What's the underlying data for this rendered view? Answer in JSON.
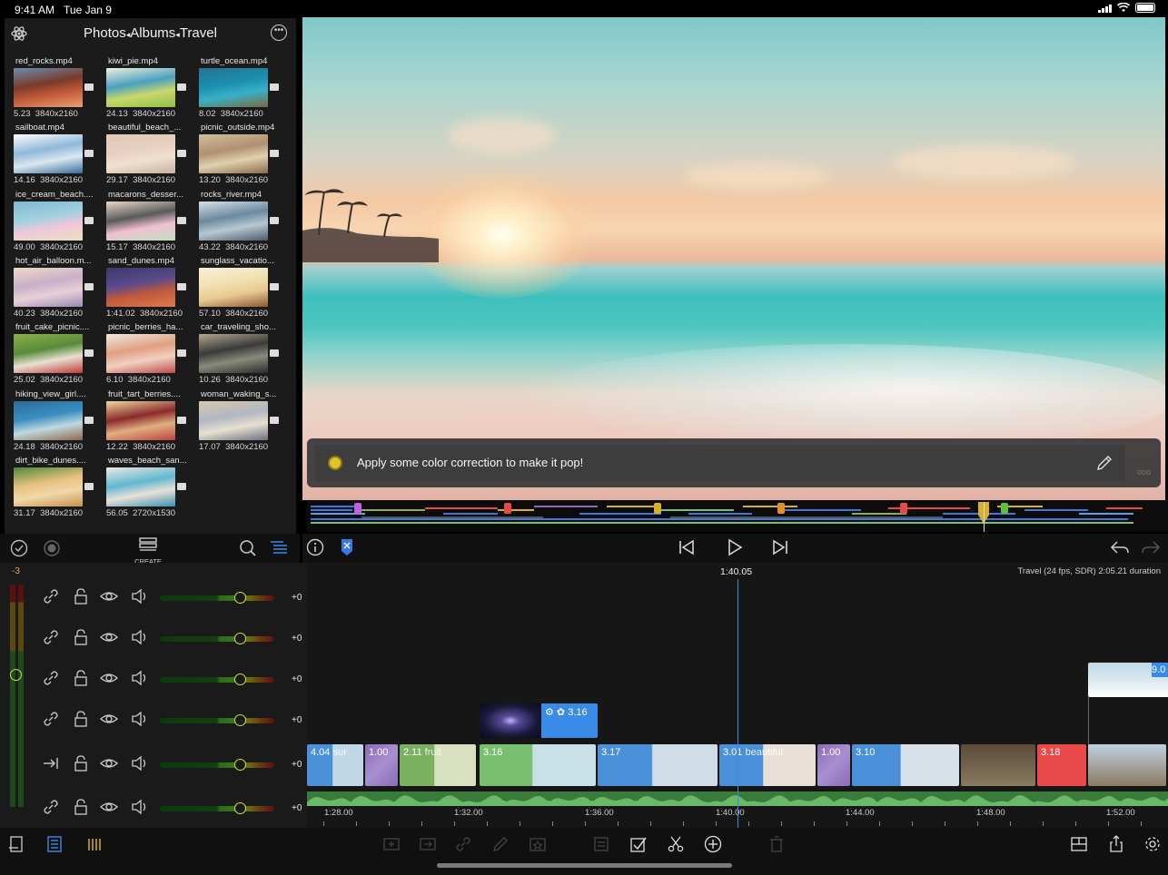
{
  "status_bar": {
    "time": "9:41 AM",
    "date": "Tue Jan 9"
  },
  "browser": {
    "path": [
      "Photos",
      "Albums",
      "Travel"
    ],
    "tiles": [
      {
        "name": "red_rocks.mp4",
        "duration": "5.23",
        "resolution": "3840x2160",
        "colors": [
          "#7a3a2a",
          "#c25a3a",
          "#e9a070",
          "#6a8fb0"
        ]
      },
      {
        "name": "kiwi_pie.mp4",
        "duration": "24.13",
        "resolution": "3840x2160",
        "colors": [
          "#4aa0c0",
          "#c9d86a",
          "#8fbf4a",
          "#f0f0e0"
        ]
      },
      {
        "name": "turtle_ocean.mp4",
        "duration": "8.02",
        "resolution": "3840x2160",
        "colors": [
          "#1a90b0",
          "#3ab0c8",
          "#7a6a3a",
          "#2a7090"
        ]
      },
      {
        "name": "sailboat.mp4",
        "duration": "14.16",
        "resolution": "3840x2160",
        "colors": [
          "#8fb8d8",
          "#d8e8f0",
          "#3a6a9a",
          "#ffffff"
        ]
      },
      {
        "name": "beautiful_beach_...",
        "duration": "29.17",
        "resolution": "3840x2160",
        "colors": [
          "#e8d0c0",
          "#f0e0d0",
          "#c8b0a0",
          "#e0c8b8"
        ]
      },
      {
        "name": "picnic_outside.mp4",
        "duration": "13.20",
        "resolution": "3840x2160",
        "colors": [
          "#b09070",
          "#e0d0b0",
          "#8a6a4a",
          "#d0c0a0"
        ]
      },
      {
        "name": "ice_cream_beach....",
        "duration": "49.00",
        "resolution": "3840x2160",
        "colors": [
          "#a0d0e0",
          "#f0c8d8",
          "#e8e0c0",
          "#80b8d0"
        ]
      },
      {
        "name": "macarons_desser...",
        "duration": "15.17",
        "resolution": "3840x2160",
        "colors": [
          "#5a5a5a",
          "#f0c0d0",
          "#c0e0c0",
          "#e8d8c8"
        ]
      },
      {
        "name": "rocks_river.mp4",
        "duration": "43.22",
        "resolution": "3840x2160",
        "colors": [
          "#6a8aa0",
          "#b8c8d0",
          "#4a5a6a",
          "#d8e0e8"
        ]
      },
      {
        "name": "hot_air_balloon.m...",
        "duration": "40.23",
        "resolution": "3840x2160",
        "colors": [
          "#c8b0c8",
          "#e8d0d8",
          "#9a8ab0",
          "#f0d8c8"
        ]
      },
      {
        "name": "sand_dunes.mp4",
        "duration": "1:41.02",
        "resolution": "3840x2160",
        "colors": [
          "#5a4a8a",
          "#c05a3a",
          "#e07a4a",
          "#3a3a6a"
        ]
      },
      {
        "name": "sunglass_vacatio...",
        "duration": "57.10",
        "resolution": "3840x2160",
        "colors": [
          "#f0e0b0",
          "#e8c890",
          "#8a5a3a",
          "#f8f0d8"
        ]
      },
      {
        "name": "fruit_cake_picnic....",
        "duration": "25.02",
        "resolution": "3840x2160",
        "colors": [
          "#5a8a3a",
          "#e8e0d0",
          "#c03a3a",
          "#8ab04a"
        ]
      },
      {
        "name": "picnic_berries_ha...",
        "duration": "6.10",
        "resolution": "3840x2160",
        "colors": [
          "#e0a080",
          "#f0d0c0",
          "#c04a4a",
          "#f0e8e0"
        ]
      },
      {
        "name": "car_traveling_sho...",
        "duration": "10.26",
        "resolution": "3840x2160",
        "colors": [
          "#3a3a3a",
          "#8a8a7a",
          "#2a2a2a",
          "#b0a890"
        ]
      },
      {
        "name": "hiking_view_girl....",
        "duration": "24.18",
        "resolution": "3840x2160",
        "colors": [
          "#3a90c0",
          "#c0d8e0",
          "#8a6a4a",
          "#2a6a9a"
        ]
      },
      {
        "name": "fruit_tart_berries....",
        "duration": "12.22",
        "resolution": "3840x2160",
        "colors": [
          "#8a2a2a",
          "#e0b080",
          "#c04040",
          "#f0d8a0"
        ]
      },
      {
        "name": "woman_waking_s...",
        "duration": "17.07",
        "resolution": "3840x2160",
        "colors": [
          "#b0b8c0",
          "#e8e0d0",
          "#6a7080",
          "#d8c8b0"
        ]
      },
      {
        "name": "dirt_bike_dunes....",
        "duration": "31.17",
        "resolution": "3840x2160",
        "colors": [
          "#e8c080",
          "#f0d8a8",
          "#c89050",
          "#4a8a3a"
        ]
      },
      {
        "name": "waves_beach_san...",
        "duration": "56.05",
        "resolution": "2720x1530",
        "colors": [
          "#60b8d0",
          "#e8e0d8",
          "#3a90b0",
          "#f0e8e0"
        ]
      }
    ]
  },
  "browser_toolbar": {
    "create_label": "CREATE"
  },
  "comment": {
    "text": "Apply some color correction to make it pop!"
  },
  "timeline": {
    "level_indicator": "-3",
    "playhead_time": "1:40.05",
    "project_info": "Travel (24 fps, SDR) 2:05.21 duration",
    "track_gains": [
      "+0",
      "+0",
      "+0",
      "+0",
      "+0",
      "+0"
    ],
    "ruler": [
      "1:28.00",
      "1:32.00",
      "1:36.00",
      "1:40.00",
      "1:44.00",
      "1:48.00",
      "1:52.00"
    ],
    "overlay_clip_label": "3.16",
    "top_right_clip_label": "9.0",
    "main_clips": [
      {
        "label": "4.04",
        "suffix": "sur",
        "color": "#4a90d8"
      },
      {
        "label": "1.00",
        "suffix": "",
        "color": "#8a6ab8"
      },
      {
        "label": "2.11",
        "suffix": "fruit",
        "color": "#7ab060"
      },
      {
        "label": "3.16",
        "suffix": "",
        "color": "#78c070"
      },
      {
        "label": "3.17",
        "suffix": "",
        "color": "#4a90d8"
      },
      {
        "label": "3.01",
        "suffix": "beautiful",
        "color": "#4a90d8"
      },
      {
        "label": "1.00",
        "suffix": "",
        "color": "#8a6ab8"
      },
      {
        "label": "3.10",
        "suffix": "",
        "color": "#4a90d8"
      },
      {
        "label": "3.18",
        "suffix": "",
        "color": "#e84a4a"
      }
    ]
  }
}
